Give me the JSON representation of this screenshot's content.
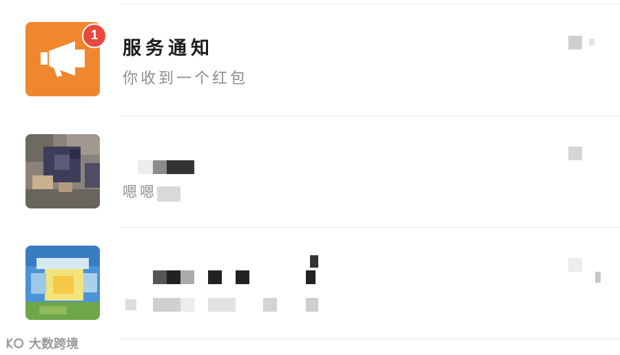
{
  "chat_list": {
    "items": [
      {
        "name": "服务通知",
        "preview": "你收到一个红包",
        "unread_count": "1",
        "avatar_icon": "megaphone-icon",
        "avatar_color": "#f0872e"
      },
      {
        "name": "",
        "preview": "嗯嗯",
        "avatar_icon": "photo-avatar"
      },
      {
        "name": "",
        "preview": "",
        "avatar_icon": "sky-photo-avatar"
      }
    ]
  },
  "watermark": {
    "text": "大数跨境"
  }
}
